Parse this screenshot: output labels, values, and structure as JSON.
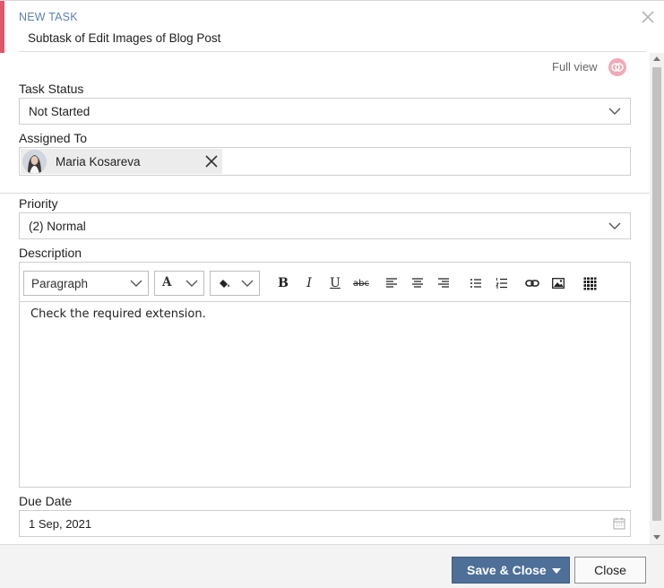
{
  "header": {
    "kicker": "NEW TASK",
    "title": "Subtask of Edit Images of Blog Post",
    "full_view_label": "Full view"
  },
  "fields": {
    "task_status": {
      "label": "Task Status",
      "value": "Not Started"
    },
    "assigned_to": {
      "label": "Assigned To",
      "assignee": "Maria Kosareva"
    },
    "priority": {
      "label": "Priority",
      "value": "(2) Normal"
    },
    "description": {
      "label": "Description",
      "format_value": "Paragraph",
      "font_glyph": "A",
      "content": "Check the required extension."
    },
    "due_date": {
      "label": "Due Date",
      "value": "1 Sep, 2021"
    }
  },
  "toolbar": {
    "bold": "B",
    "italic": "I",
    "underline": "U",
    "strike": "abc"
  },
  "footer": {
    "save_label": "Save & Close",
    "close_label": "Close"
  },
  "colors": {
    "accent": "#e2556a",
    "header_kicker": "#5b82b3",
    "primary_button": "#4d6f98",
    "full_view_icon": "#f2a9b7"
  },
  "icons": {
    "close": "close-icon",
    "full_view": "full-view-icon",
    "chevron": "chevron-down-icon",
    "remove": "remove-assignee-icon",
    "calendar": "calendar-icon"
  }
}
